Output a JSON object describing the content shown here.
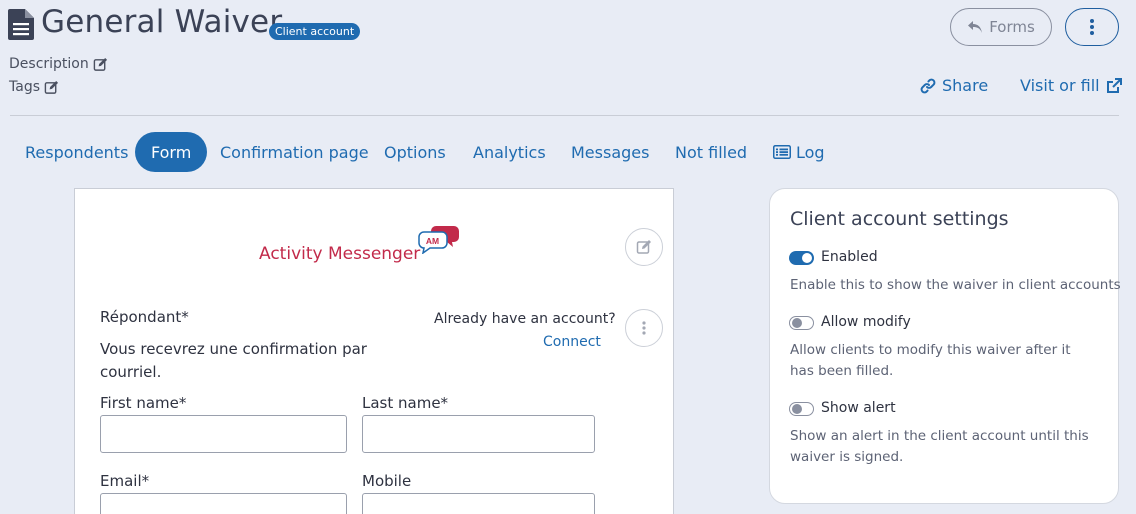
{
  "header": {
    "title": "General Waiver",
    "badge": "Client account",
    "description_label": "Description",
    "tags_label": "Tags",
    "forms_button": "Forms",
    "share_label": "Share",
    "visit_label": "Visit or fill"
  },
  "tabs": [
    {
      "label": "Respondents"
    },
    {
      "label": "Form",
      "active": true
    },
    {
      "label": "Confirmation page"
    },
    {
      "label": "Options"
    },
    {
      "label": "Analytics"
    },
    {
      "label": "Messages"
    },
    {
      "label": "Not filled"
    },
    {
      "label": "Log"
    }
  ],
  "form": {
    "logo_text": "Activity Messenger",
    "logo_badge": "AM",
    "respondent_label": "Répondant*",
    "confirmation_text": "Vous recevrez une confirmation par courriel.",
    "already_account": "Already have an account?",
    "connect_link": "Connect",
    "fields": {
      "first_name": {
        "label": "First name*",
        "value": ""
      },
      "last_name": {
        "label": "Last name*",
        "value": ""
      },
      "email": {
        "label": "Email*",
        "value": ""
      },
      "mobile": {
        "label": "Mobile",
        "value": ""
      }
    }
  },
  "settings": {
    "title": "Client account settings",
    "options": [
      {
        "label": "Enabled",
        "enabled": true,
        "description": "Enable this to show the waiver in client accounts"
      },
      {
        "label": "Allow modify",
        "enabled": false,
        "description": "Allow clients to modify this waiver after it has been filled."
      },
      {
        "label": "Show alert",
        "enabled": false,
        "description": "Show an alert in the client account until this waiver is signed."
      }
    ]
  },
  "colors": {
    "accent": "#1f6bb0",
    "background": "#e8ecf5",
    "logo": "#c22a4a"
  }
}
